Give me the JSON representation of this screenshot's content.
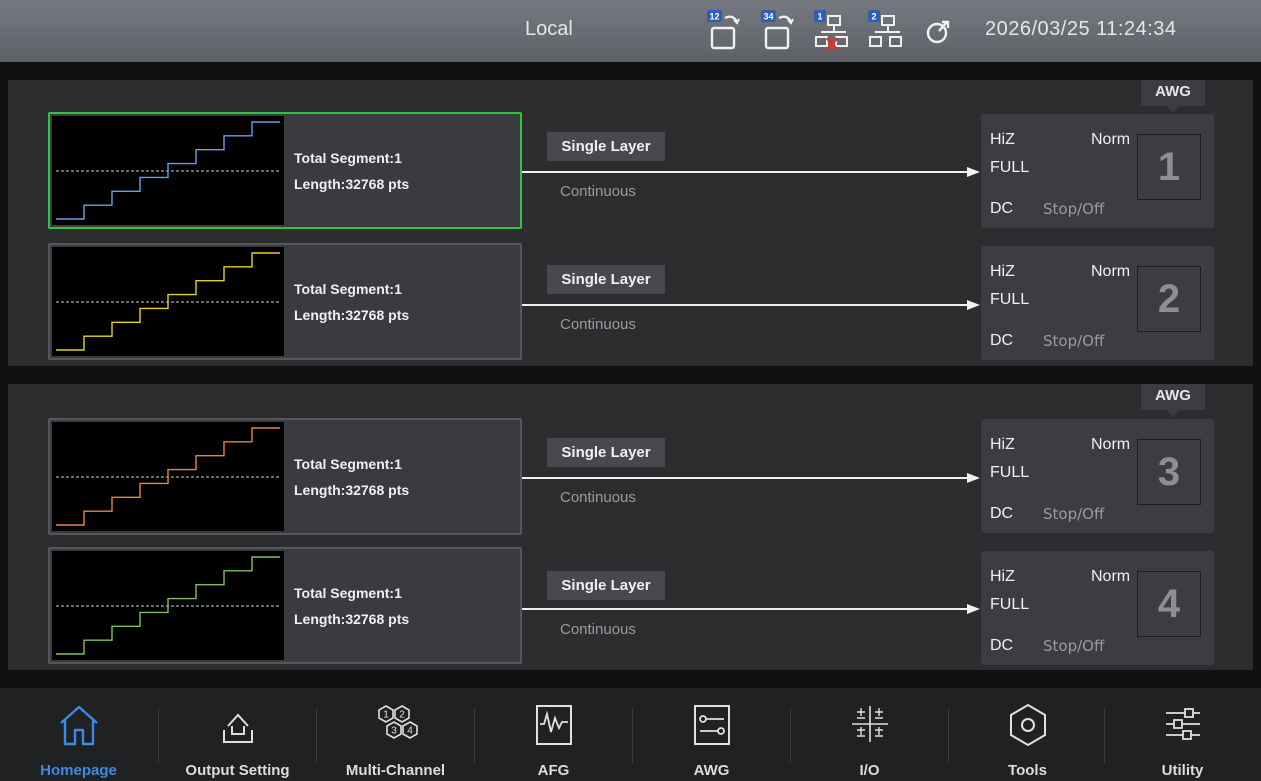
{
  "status_bar": {
    "mode": "Local",
    "datetime": "2026/03/25 11:24:34",
    "icons": [
      "channel-12-sync-icon",
      "channel-34-sync-icon",
      "network-1-disconnected-icon",
      "network-2-connected-icon",
      "refresh-icon"
    ],
    "icon_labels": {
      "ch12": "12",
      "ch34": "34",
      "net1": "1",
      "net2": "2"
    }
  },
  "groups": [
    {
      "tag": "AWG"
    },
    {
      "tag": "AWG"
    }
  ],
  "channels": [
    {
      "number": "1",
      "color": "#6aa0e8",
      "segment": "Total Segment:1",
      "length": "Length:32768 pts",
      "layer": "Single Layer",
      "mode": "Continuous",
      "impedance": "HiZ",
      "polarity": "Norm",
      "range": "FULL",
      "coupling": "DC",
      "state": "Stop/Off",
      "selected": true
    },
    {
      "number": "2",
      "color": "#e6d21e",
      "segment": "Total Segment:1",
      "length": "Length:32768 pts",
      "layer": "Single Layer",
      "mode": "Continuous",
      "impedance": "HiZ",
      "polarity": "Norm",
      "range": "FULL",
      "coupling": "DC",
      "state": "Stop/Off",
      "selected": false
    },
    {
      "number": "3",
      "color": "#e8863a",
      "segment": "Total Segment:1",
      "length": "Length:32768 pts",
      "layer": "Single Layer",
      "mode": "Continuous",
      "impedance": "HiZ",
      "polarity": "Norm",
      "range": "FULL",
      "coupling": "DC",
      "state": "Stop/Off",
      "selected": false
    },
    {
      "number": "4",
      "color": "#7fc25a",
      "segment": "Total Segment:1",
      "length": "Length:32768 pts",
      "layer": "Single Layer",
      "mode": "Continuous",
      "impedance": "HiZ",
      "polarity": "Norm",
      "range": "FULL",
      "coupling": "DC",
      "state": "Stop/Off",
      "selected": false
    }
  ],
  "nav": [
    {
      "label": "Homepage",
      "icon": "home-icon",
      "active": true
    },
    {
      "label": "Output Setting",
      "icon": "output-setting-icon",
      "active": false
    },
    {
      "label": "Multi-Channel",
      "icon": "multi-channel-icon",
      "active": false
    },
    {
      "label": "AFG",
      "icon": "afg-icon",
      "active": false
    },
    {
      "label": "AWG",
      "icon": "awg-icon",
      "active": false
    },
    {
      "label": "I/O",
      "icon": "io-icon",
      "active": false
    },
    {
      "label": "Tools",
      "icon": "tools-icon",
      "active": false
    },
    {
      "label": "Utility",
      "icon": "utility-icon",
      "active": false
    }
  ],
  "colors": {
    "accent": "#3d8be0",
    "selected_border": "#2ec445",
    "error": "#e0302a"
  }
}
